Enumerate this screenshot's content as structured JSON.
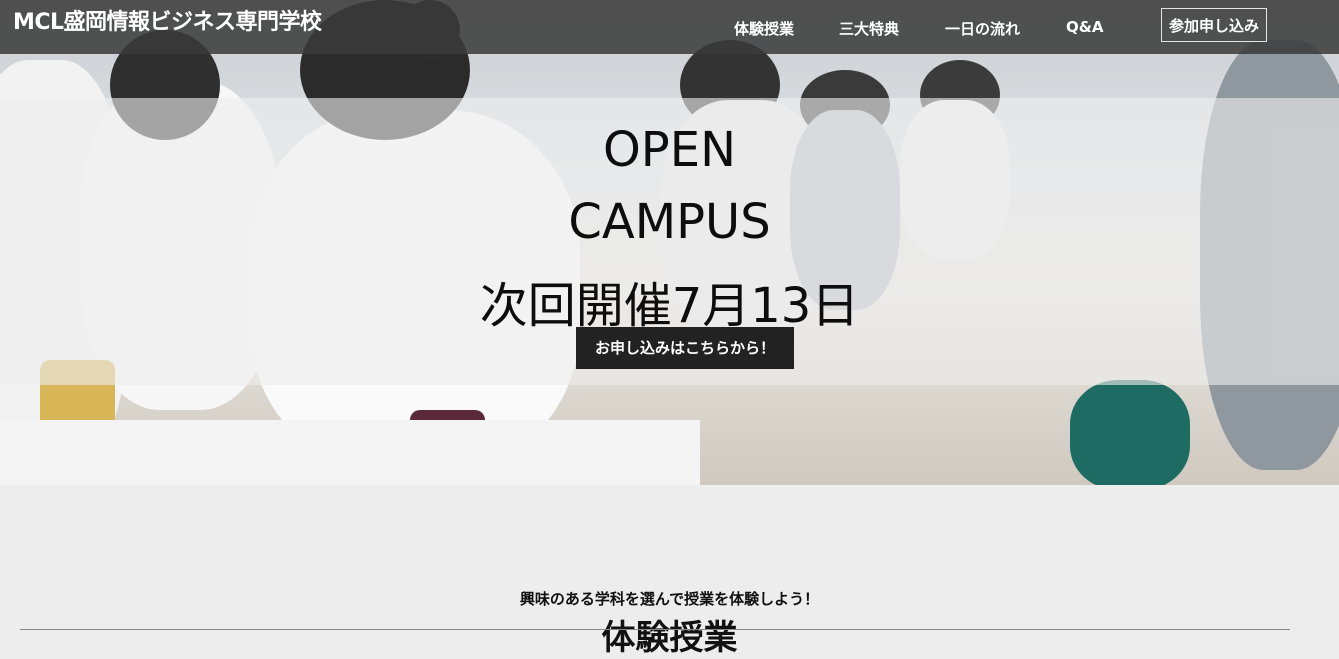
{
  "header": {
    "brand": "MCL盛岡情報ビジネス専門学校",
    "nav": [
      {
        "label": "体験授業"
      },
      {
        "label": "三大特典"
      },
      {
        "label": "一日の流れ"
      },
      {
        "label": "Q&A"
      }
    ],
    "cta_label": "参加申し込み"
  },
  "hero": {
    "line1": "OPEN",
    "line2": "CAMPUS",
    "line3": "次回開催7月13日",
    "button_label": "お申し込みはこちらから！"
  },
  "section": {
    "intro": "興味のある学科を選んで授業を体験しよう！",
    "title": "体験授業"
  }
}
